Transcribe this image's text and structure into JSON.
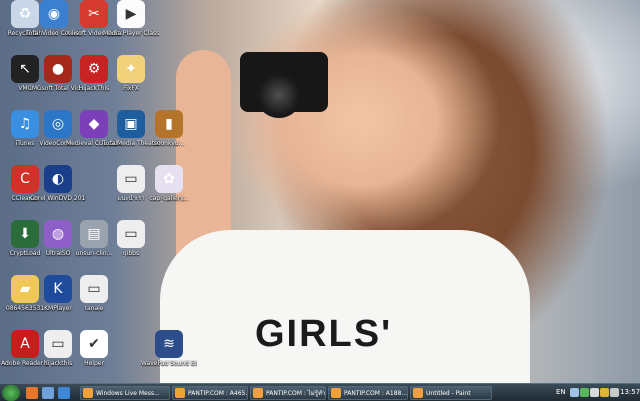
{
  "desktop": {
    "icons": [
      {
        "label": "Recycle Bin",
        "icon": "recycle-bin-icon",
        "color": "#c9d7e8",
        "glyph": "♻"
      },
      {
        "label": "Total Video Converter",
        "icon": "video-converter-icon",
        "color": "#3b7fd0",
        "glyph": "◉"
      },
      {
        "label": "Xilisoft Video Cutter",
        "icon": "video-cutter-icon",
        "color": "#d63a2e",
        "glyph": "✂"
      },
      {
        "label": "Media Player Classic - Ho...",
        "icon": "media-player-icon",
        "color": "#fbfbfb",
        "glyph": "▶"
      },
      {
        "label": "VMC",
        "icon": "vmc-icon",
        "color": "#222222",
        "glyph": "↖"
      },
      {
        "label": "iMGsoft Total Vid...",
        "icon": "imgsoft-icon",
        "color": "#a5291b",
        "glyph": "●"
      },
      {
        "label": "HijackThis",
        "icon": "hijackthis-icon",
        "color": "#c72323",
        "glyph": "⚙"
      },
      {
        "label": "FixFX",
        "icon": "fixfx-icon",
        "color": "#f1d27a",
        "glyph": "✦"
      },
      {
        "label": "iTunes",
        "icon": "itunes-icon",
        "color": "#3b8fe0",
        "glyph": "♫"
      },
      {
        "label": "VideoConv...",
        "icon": "videoconv-icon",
        "color": "#2c76c8",
        "glyph": "◎"
      },
      {
        "label": "Medieval CUE Splitter",
        "icon": "cue-splitter-icon",
        "color": "#7b3fb8",
        "glyph": "◆"
      },
      {
        "label": "TotalMedia Theatre 3",
        "icon": "totalmedia-icon",
        "color": "#1f5e9e",
        "glyph": "▣"
      },
      {
        "label": "soonkyu...",
        "icon": "image-file-icon",
        "color": "#b5742c",
        "glyph": "▮"
      },
      {
        "label": "CCleaner",
        "icon": "ccleaner-icon",
        "color": "#d3302a",
        "glyph": "C"
      },
      {
        "label": "Corel WinDVD 2010",
        "icon": "windvd-icon",
        "color": "#1b3e8a",
        "glyph": "◐"
      },
      {
        "label": "แนะนำเรา",
        "icon": "document-icon",
        "color": "#eeeeee",
        "glyph": "▭"
      },
      {
        "label": "cap_gallery...",
        "icon": "gallery-icon",
        "color": "#e6e0f0",
        "glyph": "✿"
      },
      {
        "label": "CryptLoad",
        "icon": "cryptload-icon",
        "color": "#2b6d3a",
        "glyph": "⬇"
      },
      {
        "label": "UltraISO",
        "icon": "ultraiso-icon",
        "color": "#8f5fc9",
        "glyph": "◍"
      },
      {
        "label": "unsun-clin...",
        "icon": "archive-icon",
        "color": "#9aa3ad",
        "glyph": "▤"
      },
      {
        "label": "gibbs",
        "icon": "text-file-icon",
        "color": "#eeeeee",
        "glyph": "▭"
      },
      {
        "label": "0864563531",
        "icon": "folder-icon",
        "color": "#f0c85a",
        "glyph": "▰"
      },
      {
        "label": "KMPlayer",
        "icon": "kmplayer-icon",
        "color": "#1e4c9a",
        "glyph": "K"
      },
      {
        "label": "ranale",
        "icon": "text-file-icon",
        "color": "#eeeeee",
        "glyph": "▭"
      },
      {
        "label": "Adobe Reader 9",
        "icon": "adobe-reader-icon",
        "color": "#c81d1d",
        "glyph": "A"
      },
      {
        "label": "hijackthis",
        "icon": "log-file-icon",
        "color": "#eeeeee",
        "glyph": "▭"
      },
      {
        "label": "Helper",
        "icon": "checkmark-icon",
        "color": "#ffffff",
        "glyph": "✔"
      },
      {
        "label": "WavePad Sound Editor",
        "icon": "wavepad-icon",
        "color": "#2d4d8a",
        "glyph": "≋"
      }
    ],
    "wallpaper_text": "GIRLS'"
  },
  "taskbar": {
    "start_icon": "windows-start-icon",
    "quick_launch": [
      {
        "icon": "firefox-icon",
        "color": "#e8762b"
      },
      {
        "icon": "show-desktop-icon",
        "color": "#6fa0d8"
      },
      {
        "icon": "ie-icon",
        "color": "#3f86d6"
      }
    ],
    "tasks": [
      {
        "label": "Windows Live Mess...",
        "icon": "messenger-icon"
      },
      {
        "label": "PANTIP.COM : A465...",
        "icon": "firefox-tab-icon"
      },
      {
        "label": "PANTIP.COM : ไม่รู้ทำ...",
        "icon": "firefox-tab-icon"
      },
      {
        "label": "PANTIP.COM : A188...",
        "icon": "firefox-tab-icon"
      },
      {
        "label": "Untitled - Paint",
        "icon": "paint-icon"
      }
    ],
    "language": "EN",
    "clock": "13:57",
    "tray_icons": [
      {
        "icon": "network-icon",
        "color": "#9fc2e6"
      },
      {
        "icon": "messenger-tray-icon",
        "color": "#5bb85a"
      },
      {
        "icon": "volume-icon",
        "color": "#d9d9d9"
      },
      {
        "icon": "security-icon",
        "color": "#e0b43a"
      },
      {
        "icon": "update-icon",
        "color": "#c9c9c9"
      }
    ]
  }
}
